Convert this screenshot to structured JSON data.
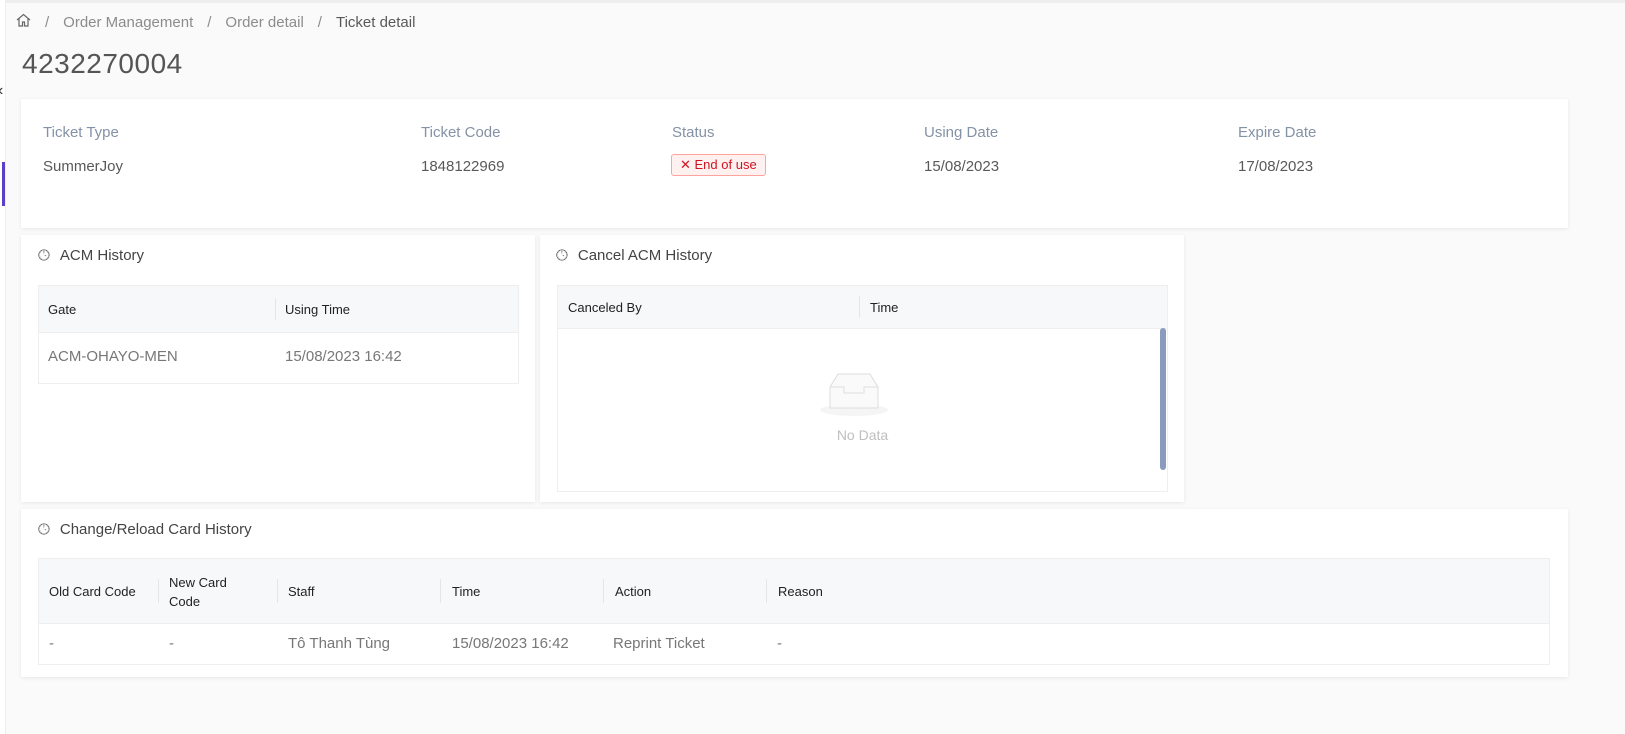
{
  "breadcrumb": {
    "items": [
      "Order Management",
      "Order detail"
    ],
    "current": "Ticket detail"
  },
  "page_title": "4232270004",
  "info": {
    "ticket_type": {
      "label": "Ticket Type",
      "value": "SummerJoy"
    },
    "ticket_code": {
      "label": "Ticket Code",
      "value": "1848122969"
    },
    "status": {
      "label": "Status",
      "value": "End of use"
    },
    "using_date": {
      "label": "Using Date",
      "value": "15/08/2023"
    },
    "expire_date": {
      "label": "Expire Date",
      "value": "17/08/2023"
    }
  },
  "acm": {
    "title": "ACM History",
    "columns": [
      "Gate",
      "Using Time"
    ],
    "rows": [
      [
        "ACM-OHAYO-MEN",
        "15/08/2023 16:42"
      ]
    ]
  },
  "cancel": {
    "title": "Cancel ACM History",
    "columns": [
      "Canceled By",
      "Time"
    ],
    "empty": "No Data"
  },
  "change": {
    "title": "Change/Reload Card History",
    "columns": [
      "Old Card Code",
      "New Card Code",
      "Staff",
      "Time",
      "Action",
      "Reason"
    ],
    "rows": [
      [
        "-",
        "-",
        "Tô Thanh Tùng",
        "15/08/2023 16:42",
        "Reprint Ticket",
        "-"
      ]
    ]
  }
}
